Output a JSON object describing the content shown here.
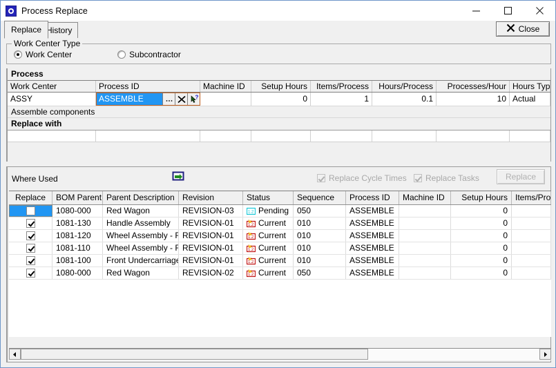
{
  "window": {
    "title": "Process Replace",
    "app_icon": "process-replace-icon",
    "minimize_label": "Minimize",
    "maximize_label": "Maximize",
    "close_label": "Close"
  },
  "tabs": [
    {
      "label": "Replace",
      "selected": true
    },
    {
      "label": "History",
      "selected": false
    }
  ],
  "toolbar": {
    "close_label": "Close",
    "close_icon": "x-icon"
  },
  "work_center_type": {
    "legend": "Work Center Type",
    "options": [
      {
        "label": "Work Center",
        "checked": true
      },
      {
        "label": "Subcontractor",
        "checked": false
      }
    ]
  },
  "process": {
    "section_label": "Process",
    "columns": [
      "Work Center",
      "Process ID",
      "Machine ID",
      "Setup Hours",
      "Items/Process",
      "Hours/Process",
      "Processes/Hour",
      "Hours Type"
    ],
    "row": {
      "work_center": "ASSY",
      "process_id": "ASSEMBLE",
      "machine_id": "",
      "setup_hours": "0",
      "items_process": "1",
      "hours_process": "0.1",
      "processes_hour": "10",
      "hours_type": "Actual"
    },
    "editor_buttons": [
      {
        "name": "ellipsis-button",
        "glyph": "…"
      },
      {
        "name": "clear-x-button",
        "glyph": "✕"
      },
      {
        "name": "drill-down-button",
        "glyph": "?"
      }
    ],
    "description": "Assemble components",
    "replace_with_label": "Replace with",
    "replace_with_row": {
      "work_center": "",
      "process_id": "",
      "machine_id": "",
      "setup_hours": "",
      "items_process": "",
      "hours_process": "",
      "processes_hour": "",
      "hours_type": ""
    }
  },
  "where_used": {
    "label": "Where Used",
    "export_icon": "export-to-excel-icon",
    "options": [
      {
        "label": "Replace Cycle Times",
        "checked": true,
        "disabled": true
      },
      {
        "label": "Replace Tasks",
        "checked": true,
        "disabled": true
      }
    ],
    "replace_button": {
      "label": "Replace",
      "disabled": true
    },
    "columns": [
      "Replace",
      "BOM Parent",
      "Parent Description",
      "Revision",
      "Status",
      "Sequence",
      "Process ID",
      "Machine ID",
      "Setup Hours",
      "Items/Proce"
    ],
    "rows": [
      {
        "replace": false,
        "selected": true,
        "bom_parent": "1080-000",
        "parent_description": "Red Wagon",
        "revision": "REVISION-03",
        "status": "Pending",
        "status_icon": "pending-revision-icon",
        "sequence": "050",
        "process_id": "ASSEMBLE",
        "machine_id": "",
        "setup_hours": "0",
        "items_process": ""
      },
      {
        "replace": true,
        "selected": false,
        "bom_parent": "1081-130",
        "parent_description": "Handle Assembly",
        "revision": "REVISION-01",
        "status": "Current",
        "status_icon": "current-revision-icon",
        "sequence": "010",
        "process_id": "ASSEMBLE",
        "machine_id": "",
        "setup_hours": "0",
        "items_process": ""
      },
      {
        "replace": true,
        "selected": false,
        "bom_parent": "1081-120",
        "parent_description": "Wheel Assembly - Rear",
        "revision": "REVISION-01",
        "status": "Current",
        "status_icon": "current-revision-icon",
        "sequence": "010",
        "process_id": "ASSEMBLE",
        "machine_id": "",
        "setup_hours": "0",
        "items_process": ""
      },
      {
        "replace": true,
        "selected": false,
        "bom_parent": "1081-110",
        "parent_description": "Wheel Assembly - Front",
        "revision": "REVISION-01",
        "status": "Current",
        "status_icon": "current-revision-icon",
        "sequence": "010",
        "process_id": "ASSEMBLE",
        "machine_id": "",
        "setup_hours": "0",
        "items_process": ""
      },
      {
        "replace": true,
        "selected": false,
        "bom_parent": "1081-100",
        "parent_description": "Front Undercarriage Assembly",
        "revision": "REVISION-01",
        "status": "Current",
        "status_icon": "current-revision-icon",
        "sequence": "010",
        "process_id": "ASSEMBLE",
        "machine_id": "",
        "setup_hours": "0",
        "items_process": ""
      },
      {
        "replace": true,
        "selected": false,
        "bom_parent": "1080-000",
        "parent_description": "Red Wagon",
        "revision": "REVISION-02",
        "status": "Current",
        "status_icon": "current-revision-icon",
        "sequence": "050",
        "process_id": "ASSEMBLE",
        "machine_id": "",
        "setup_hours": "0",
        "items_process": ""
      }
    ],
    "scrollbar": {
      "left_arrow": "◀",
      "right_arrow": "▶",
      "thumb_fraction": "0.67"
    }
  },
  "colors": {
    "window_border": "#6e96c8",
    "selection_blue": "#2196f3",
    "face": "#f0f0f0",
    "disabled_text": "#a8a8a8"
  }
}
